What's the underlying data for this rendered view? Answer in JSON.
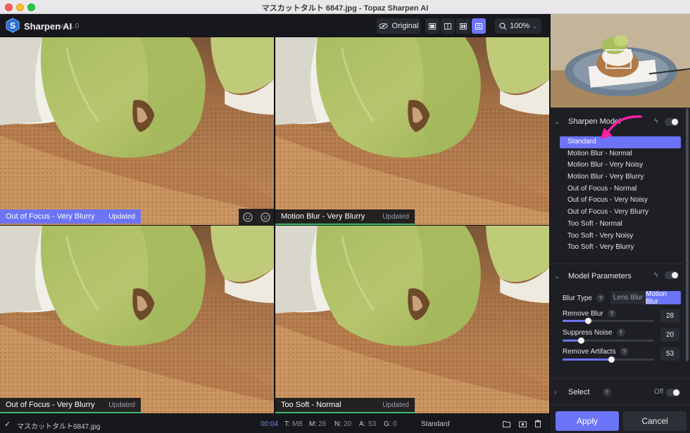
{
  "window": {
    "title": "マスカットタルト 6847.jpg - Topaz Sharpen AI"
  },
  "app": {
    "name": "Sharpen AI",
    "version": "v4.1.0"
  },
  "toolbar": {
    "original_label": "Original",
    "zoom": "100%"
  },
  "panes": [
    {
      "label": "Out of Focus - Very Blurry",
      "status": "Updated"
    },
    {
      "label": "Motion Blur - Very Blurry",
      "status": "Updated"
    },
    {
      "label": "Out of Focus - Very Blurry",
      "status": "Updated"
    },
    {
      "label": "Too Soft - Normal",
      "status": "Updated"
    }
  ],
  "statusbar": {
    "filename": "マスカットタルト6847.jpg",
    "time": "00:04",
    "t_label": "T:",
    "t_value": "MB",
    "m_label": "M:",
    "m_value": "28",
    "n_label": "N:",
    "n_value": "20",
    "a_label": "A:",
    "a_value": "53",
    "g_label": "G:",
    "g_value": "0",
    "model": "Standard"
  },
  "sharpen_model": {
    "title": "Sharpen Model",
    "items": [
      "Standard",
      "Motion Blur - Normal",
      "Motion Blur - Very Noisy",
      "Motion Blur - Very Blurry",
      "Out of Focus - Normal",
      "Out of Focus - Very Noisy",
      "Out of Focus - Very Blurry",
      "Too Soft - Normal",
      "Too Soft - Very Noisy",
      "Too Soft - Very Blurry"
    ],
    "selected": "Standard"
  },
  "model_parameters": {
    "title": "Model Parameters",
    "blur_type_label": "Blur Type",
    "blur_type_options": [
      "Lens Blur",
      "Motion Blur"
    ],
    "blur_type_selected": "Motion Blur",
    "remove_blur_label": "Remove Blur",
    "remove_blur": "28",
    "suppress_noise_label": "Suppress Noise",
    "suppress_noise": "20",
    "remove_artifacts_label": "Remove Artifacts",
    "remove_artifacts": "53"
  },
  "select": {
    "title": "Select",
    "state": "Off"
  },
  "actions": {
    "apply": "Apply",
    "cancel": "Cancel"
  },
  "colors": {
    "accent": "#6b74f6",
    "annotation": "#ff1fa8",
    "progress": "#3cbf6a"
  }
}
